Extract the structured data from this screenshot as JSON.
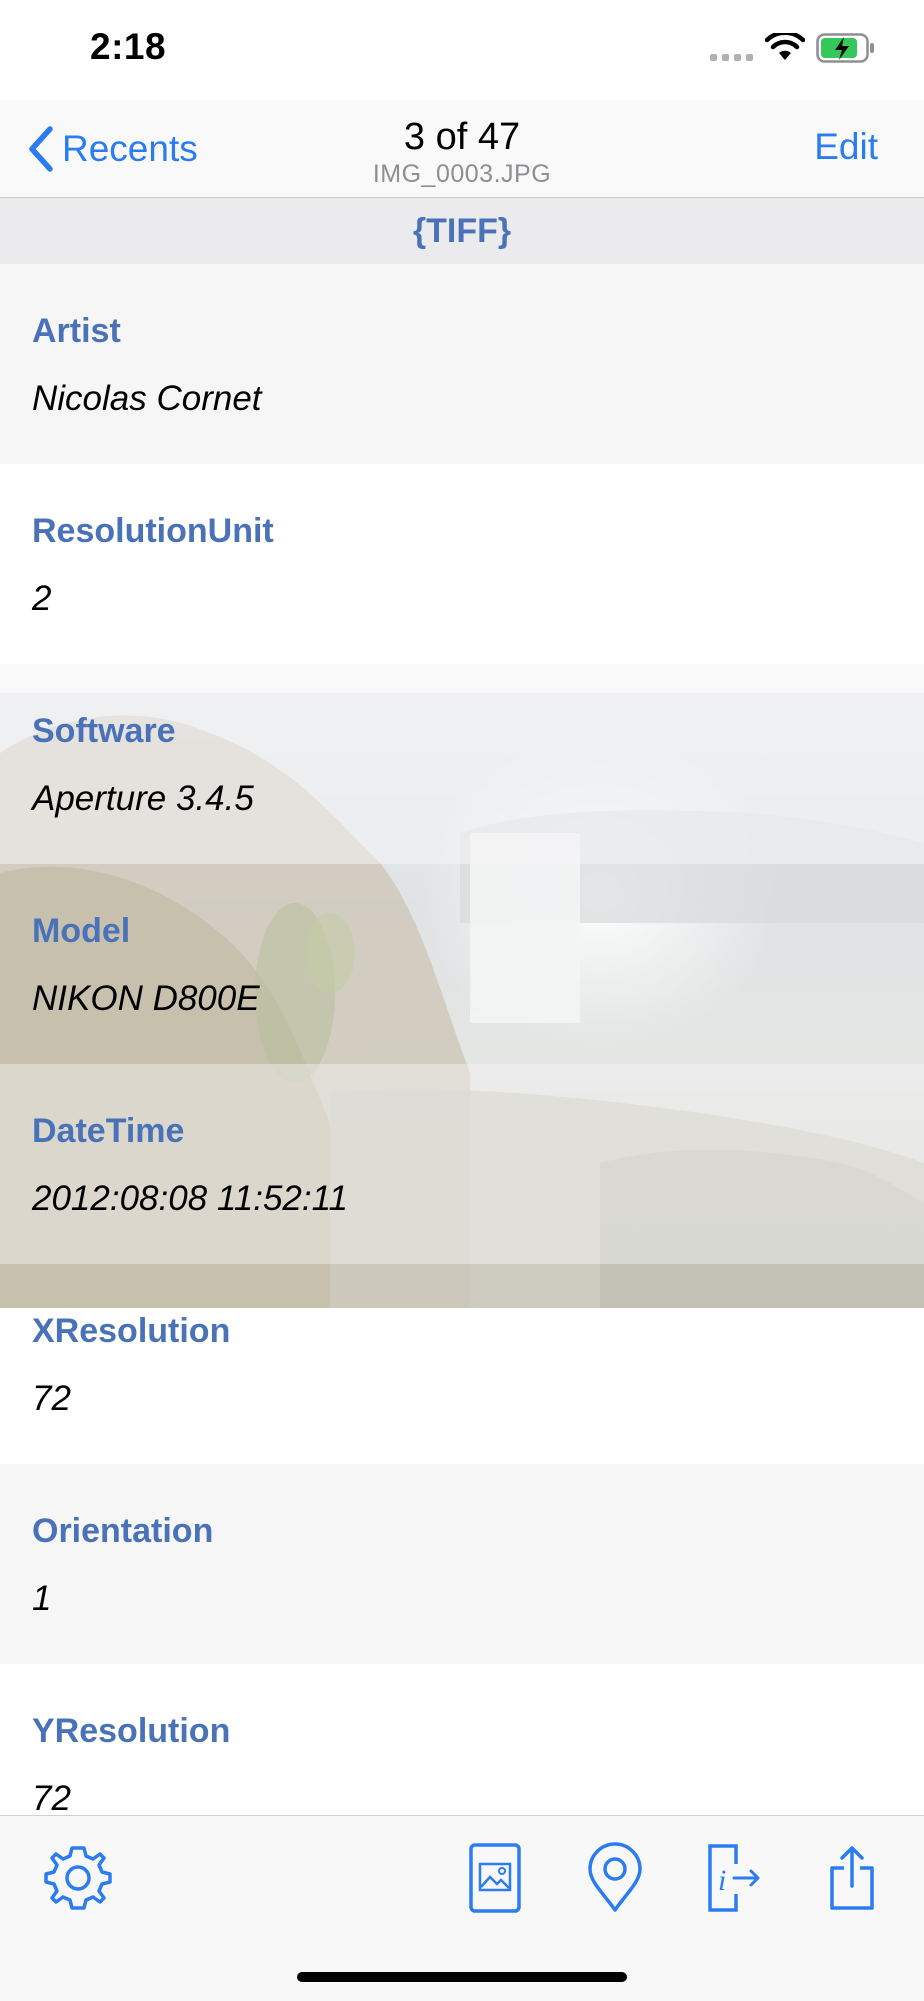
{
  "status_bar": {
    "time": "2:18"
  },
  "nav": {
    "back_label": "Recents",
    "title": "3 of 47",
    "subtitle": "IMG_0003.JPG",
    "edit_label": "Edit"
  },
  "section": {
    "title": "{TIFF}"
  },
  "rows": [
    {
      "key": "Artist",
      "value": "Nicolas Cornet"
    },
    {
      "key": "ResolutionUnit",
      "value": "2"
    },
    {
      "key": "Software",
      "value": "Aperture 3.4.5"
    },
    {
      "key": "Model",
      "value": "NIKON D800E"
    },
    {
      "key": "DateTime",
      "value": "2012:08:08 11:52:11"
    },
    {
      "key": "XResolution",
      "value": "72"
    },
    {
      "key": "Orientation",
      "value": "1"
    },
    {
      "key": "YResolution",
      "value": "72"
    }
  ],
  "toolbar": {
    "icons": [
      "gear-icon",
      "photo-icon",
      "location-pin-icon",
      "info-export-icon",
      "share-icon"
    ]
  },
  "colors": {
    "accent": "#2a7cf0",
    "key_text": "#4a72b8",
    "section_bg": "#ebebed"
  }
}
